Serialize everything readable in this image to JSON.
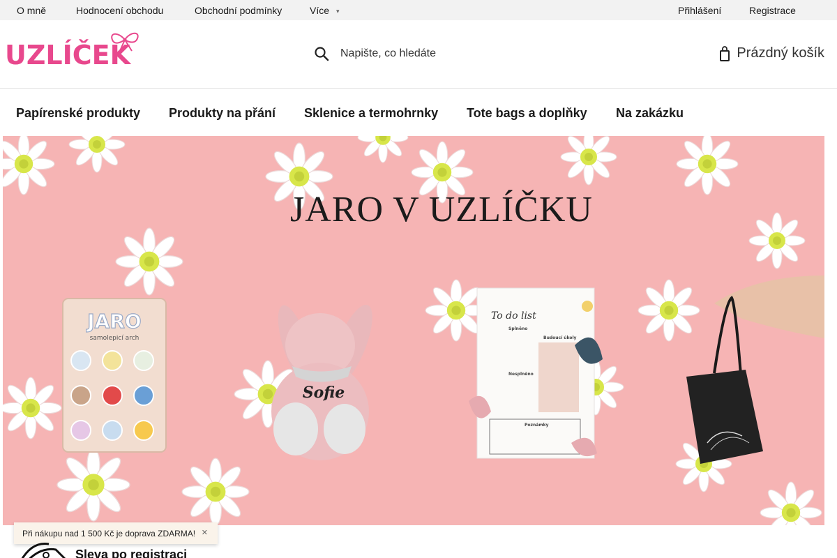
{
  "topbar": {
    "links": [
      "O mně",
      "Hodnocení obchodu",
      "Obchodní podmínky",
      "Více"
    ],
    "login": "Přihlášení",
    "register": "Registrace"
  },
  "header": {
    "logo_text": "UZLÍČEK",
    "search_placeholder": "Napište, co hledáte",
    "cart_label": "Prázdný košík"
  },
  "nav": {
    "items": [
      "Papírenské produkty",
      "Produkty na přání",
      "Sklenice a termohrnky",
      "Tote bags a doplňky",
      "Na zakázku"
    ]
  },
  "banner": {
    "title": "JARO V UZLÍČKU",
    "sticker_sheet_title": "JARO",
    "sticker_sheet_subtitle": "samolepicí arch",
    "plush_name": "Sofie",
    "todo_title": "To do list",
    "todo_sections": [
      "Splněno",
      "Budoucí úkoly",
      "Nesplněno",
      "Poznámky"
    ]
  },
  "promo": {
    "text": "Při nákupu nad 1 500 Kč je doprava ZDARMA!",
    "close_icon": "close-icon"
  },
  "discount": {
    "title": "Sleva po registraci"
  },
  "colors": {
    "brand": "#e8488d",
    "banner_bg": "#f6b4b4",
    "topbar_bg": "#f2f2f2",
    "promo_bg": "#faf3ea"
  }
}
